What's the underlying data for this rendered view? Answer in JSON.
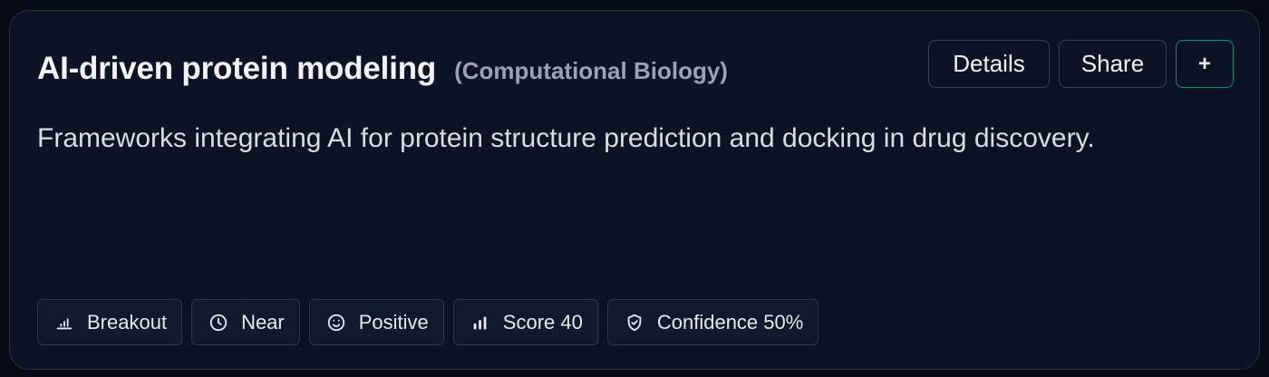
{
  "card": {
    "title": "AI-driven protein modeling",
    "category": "(Computational Biology)",
    "description": "Frameworks integrating AI for protein structure prediction and docking in drug discovery."
  },
  "actions": {
    "details_label": "Details",
    "share_label": "Share",
    "add_label": "+"
  },
  "tags": {
    "trend": {
      "label": "Breakout",
      "icon": "bar-chart-small-icon"
    },
    "horizon": {
      "label": "Near",
      "icon": "clock-icon"
    },
    "sentiment": {
      "label": "Positive",
      "icon": "smile-icon"
    },
    "score": {
      "label": "Score 40",
      "icon": "bar-chart-icon"
    },
    "confidence": {
      "label": "Confidence 50%",
      "icon": "shield-icon"
    }
  },
  "colors": {
    "background": "#070b16",
    "card": "#0c1324",
    "accent_border": "#1f8a6e"
  }
}
